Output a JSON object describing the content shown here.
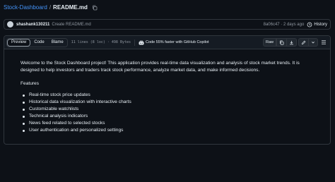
{
  "breadcrumb": {
    "repo": "Stock-Dashboard",
    "separator": "/",
    "file": "README.md"
  },
  "commit": {
    "user": "shashank130211",
    "message": "Create README.md",
    "hash_time": "8a06c47 · 2 days ago",
    "history_label": "History"
  },
  "file_header": {
    "tabs": [
      "Preview",
      "Code",
      "Blame"
    ],
    "active_tab": "Preview",
    "meta": "11 lines (8 loc) · 498 Bytes",
    "copilot_label": "Code 55% faster with GitHub Copilot",
    "raw_label": "Raw"
  },
  "readme": {
    "intro": "Welcome to the Stock Dashboard project! This application provides real-time data visualization and analysis of stock market trends. It is designed to help investors and traders track stock performance, analyze market data, and make informed decisions.",
    "features_title": "Features",
    "features": [
      "Real-time stock price updates",
      "Historical data visualization with interactive charts",
      "Customizable watchlists",
      "Technical analysis indicators",
      "News feed related to selected stocks",
      "User authentication and personalized settings"
    ]
  },
  "colors": {
    "background": "#0d1117",
    "link": "#4493f8",
    "border": "#30363d",
    "muted": "#9198a1",
    "text": "#e6edf3"
  }
}
